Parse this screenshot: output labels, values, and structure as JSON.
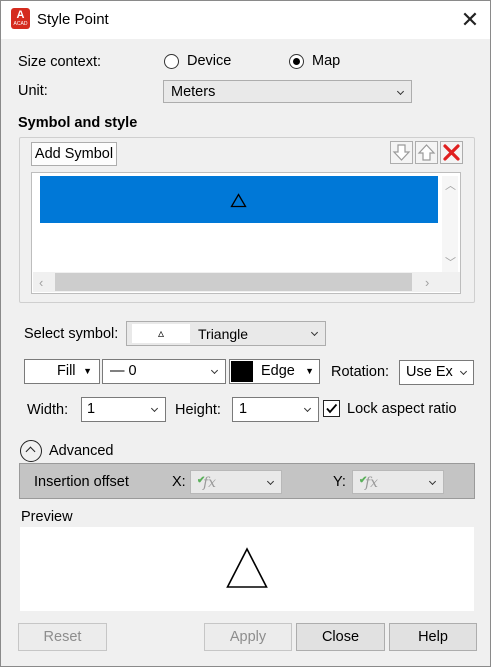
{
  "window": {
    "title": "Style Point",
    "app_icon_letter": "A",
    "app_icon_sub": "ACAD"
  },
  "size_context": {
    "label": "Size context:",
    "options": [
      {
        "label": "Device",
        "selected": false
      },
      {
        "label": "Map",
        "selected": true
      }
    ]
  },
  "unit": {
    "label": "Unit:",
    "value": "Meters"
  },
  "symbol_section": {
    "heading": "Symbol and style",
    "add_symbol_label": "Add Symbol",
    "list_rows": [
      {
        "symbol": "△",
        "selected": true
      }
    ]
  },
  "select_symbol": {
    "label": "Select symbol:",
    "glyph": "▵",
    "value": "Triangle"
  },
  "style_row": {
    "fill_label": "Fill",
    "lineweight_value": "— 0",
    "edge_label": "Edge",
    "edge_color": "#000000",
    "rotation_label": "Rotation:",
    "rotation_value": "Use Ex"
  },
  "size_row": {
    "width_label": "Width:",
    "width_value": "1",
    "height_label": "Height:",
    "height_value": "1",
    "lock_label": "Lock aspect ratio",
    "lock_checked": true
  },
  "advanced": {
    "label": "Advanced",
    "insertion_offset_label": "Insertion offset",
    "x_label": "X:",
    "y_label": "Y:",
    "fx_glyph": "fx"
  },
  "preview": {
    "label": "Preview",
    "symbol": "triangle"
  },
  "buttons": {
    "reset": "Reset",
    "apply": "Apply",
    "close": "Close",
    "help": "Help"
  },
  "colors": {
    "selection": "#0078d7",
    "delete_red": "#e02020",
    "app_red": "#d52b1e"
  }
}
